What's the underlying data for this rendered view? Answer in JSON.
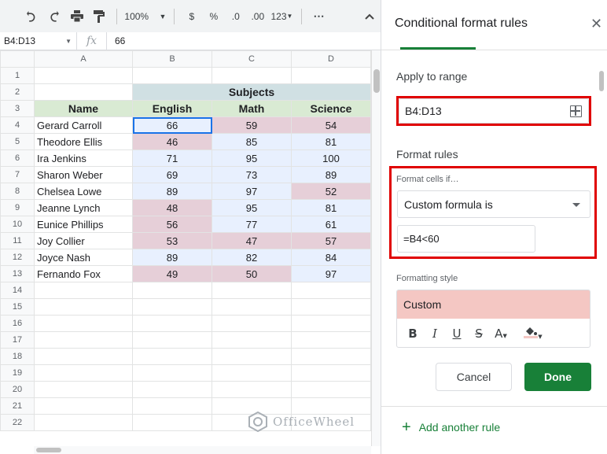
{
  "toolbar": {
    "zoom": "100%",
    "currency": "$",
    "percent": "%",
    "dec_decrease": ".0",
    "dec_increase": ".00",
    "number_format": "123"
  },
  "formula_bar": {
    "name_box": "B4:D13",
    "fx": "fx",
    "value": "66"
  },
  "sheet": {
    "columns": [
      "A",
      "B",
      "C",
      "D"
    ],
    "rows": [
      "1",
      "2",
      "3",
      "4",
      "5",
      "6",
      "7",
      "8",
      "9",
      "10",
      "11",
      "12",
      "13",
      "14",
      "15",
      "16",
      "17",
      "18",
      "19",
      "20",
      "21",
      "22"
    ],
    "subjects_header": "Subjects",
    "headers": [
      "Name",
      "English",
      "Math",
      "Science"
    ],
    "students": [
      {
        "name": "Gerard Carroll",
        "english": "66",
        "math": "59",
        "science": "54"
      },
      {
        "name": "Theodore Ellis",
        "english": "46",
        "math": "85",
        "science": "81"
      },
      {
        "name": "Ira Jenkins",
        "english": "71",
        "math": "95",
        "science": "100"
      },
      {
        "name": "Sharon Weber",
        "english": "69",
        "math": "73",
        "science": "89"
      },
      {
        "name": "Chelsea Lowe",
        "english": "89",
        "math": "97",
        "science": "52"
      },
      {
        "name": "Jeanne Lynch",
        "english": "48",
        "math": "95",
        "science": "81"
      },
      {
        "name": "Eunice Phillips",
        "english": "56",
        "math": "77",
        "science": "61"
      },
      {
        "name": "Joy Collier",
        "english": "53",
        "math": "47",
        "science": "57"
      },
      {
        "name": "Joyce Nash",
        "english": "89",
        "math": "82",
        "science": "84"
      },
      {
        "name": "Fernando Fox",
        "english": "49",
        "math": "50",
        "science": "97"
      }
    ]
  },
  "panel": {
    "title": "Conditional format rules",
    "apply_to_range_label": "Apply to range",
    "range_value": "B4:D13",
    "format_rules_label": "Format rules",
    "format_cells_if_label": "Format cells if…",
    "condition": "Custom formula is",
    "formula": "=B4<60",
    "formatting_style_label": "Formatting style",
    "style_preview": "Custom",
    "style_tools": [
      "B",
      "I",
      "U",
      "S",
      "A"
    ],
    "cancel_label": "Cancel",
    "done_label": "Done",
    "add_rule_label": "Add another rule"
  },
  "watermark": "OfficeWheel",
  "colors": {
    "header_green": "#d9ead3",
    "subjects_teal": "#d0e0e3",
    "range_fill": "#e8f0fe",
    "highlight_pink": "#e6cfd8",
    "style_pink": "#f4c7c3",
    "done_green": "#188038",
    "annotation_red": "#e00000"
  }
}
